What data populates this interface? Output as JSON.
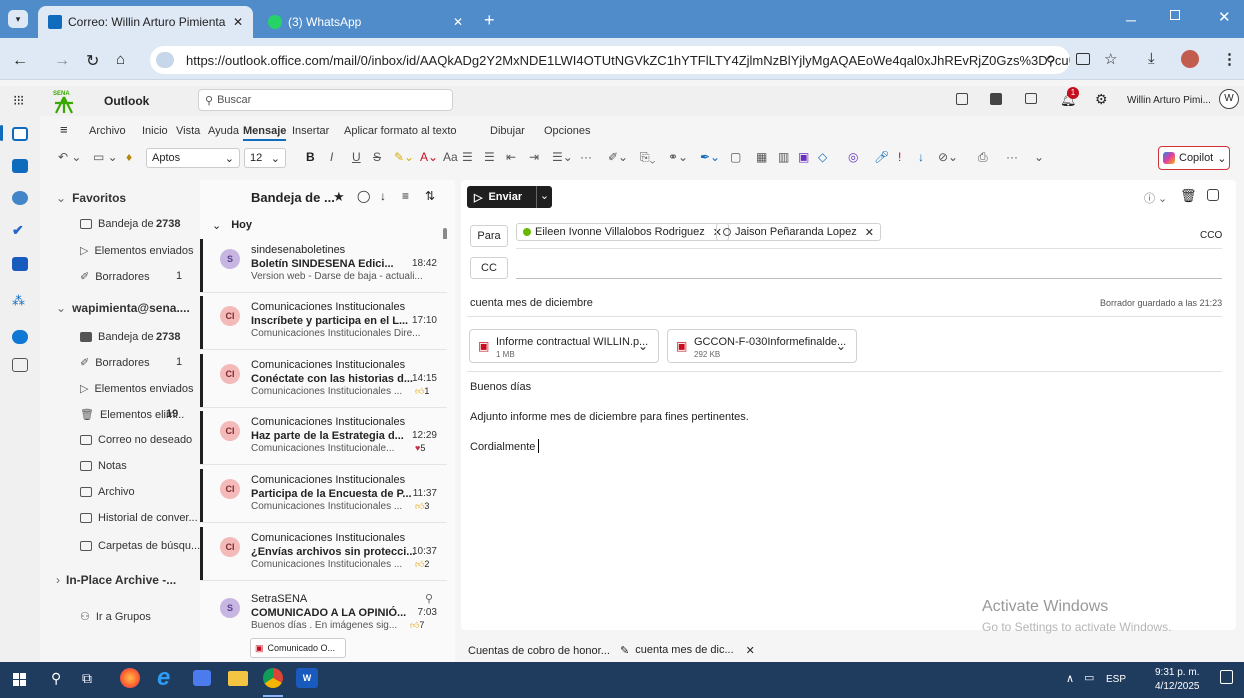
{
  "browser": {
    "tabs": [
      {
        "label": "Correo: Willin Arturo Pimienta I",
        "close": "✕"
      },
      {
        "label": "(3) WhatsApp",
        "close": "✕"
      }
    ],
    "new_tab": "+",
    "url": "https://outlook.office.com/mail/0/inbox/id/AAQkADg2Y2MxNDE1LWI4OTUtNGVkZC1hYTFlLTY4ZjlmNzBlYjlyMgAQAEoWe4qal0xJhREvRjZ0Gzs%3D?cult..."
  },
  "outlook": {
    "app_name": "Outlook",
    "search_placeholder": "Buscar",
    "user_name": "Willin Arturo Pimi...",
    "avatar_initial": "W",
    "notif_count": "1"
  },
  "ribbon": {
    "menu": [
      "Archivo",
      "Inicio",
      "Vista",
      "Ayuda",
      "Mensaje",
      "Insertar",
      "Aplicar formato al texto",
      "Dibujar",
      "Opciones"
    ],
    "font_name": "Aptos",
    "font_size": "12",
    "copilot": "Copilot"
  },
  "folders": {
    "favorites_label": "Favoritos",
    "favorites": [
      {
        "label": "Bandeja de ...",
        "count": "2738"
      },
      {
        "label": "Elementos enviados",
        "count": ""
      },
      {
        "label": "Borradores",
        "count": "1"
      }
    ],
    "account_label": "wapimienta@sena....",
    "account": [
      {
        "label": "Bandeja de ...",
        "count": "2738"
      },
      {
        "label": "Borradores",
        "count": "1"
      },
      {
        "label": "Elementos enviados",
        "count": ""
      },
      {
        "label": "Elementos elim...",
        "count": "19"
      },
      {
        "label": "Correo no deseado",
        "count": ""
      },
      {
        "label": "Notas",
        "count": ""
      },
      {
        "label": "Archivo",
        "count": ""
      },
      {
        "label": "Historial de conver...",
        "count": ""
      },
      {
        "label": "Carpetas de búsqu...",
        "count": ""
      }
    ],
    "archive_label": "In-Place Archive -...",
    "groups_label": "Ir a Grupos"
  },
  "message_list": {
    "title": "Bandeja de ...",
    "group_label": "Hoy",
    "messages": [
      {
        "initials": "S",
        "from": "sindesenaboletines",
        "subject": "Boletín SINDESENA Edici...",
        "time": "18:42",
        "preview": "Version web - Darse de baja - actuali...",
        "reactions": ""
      },
      {
        "initials": "CI",
        "from": "Comunicaciones Institucionales",
        "subject": "Inscríbete y participa en el L...",
        "time": "17:10",
        "preview": "Comunicaciones Institucionales Dire...",
        "reactions": ""
      },
      {
        "initials": "CI",
        "from": "Comunicaciones Institucionales",
        "subject": "Conéctate con las historias d...",
        "time": "14:15",
        "preview": "Comunicaciones Institucionales ...",
        "reactions": "1"
      },
      {
        "initials": "CI",
        "from": "Comunicaciones Institucionales",
        "subject": "Haz parte de la Estrategia d...",
        "time": "12:29",
        "preview": "Comunicaciones Institucionale...",
        "reactions": "5"
      },
      {
        "initials": "CI",
        "from": "Comunicaciones Institucionales",
        "subject": "Participa de la Encuesta de P...",
        "time": "11:37",
        "preview": "Comunicaciones Institucionales ...",
        "reactions": "3"
      },
      {
        "initials": "CI",
        "from": "Comunicaciones Institucionales",
        "subject": "¿Envías archivos sin protecci...",
        "time": "10:37",
        "preview": "Comunicaciones Institucionales ...",
        "reactions": "2"
      },
      {
        "initials": "S",
        "from": "SetraSENA",
        "subject": "COMUNICADO A LA OPINIÓ...",
        "time": "7:03",
        "preview": "Buenos días . En imágenes sig...",
        "reactions": "7"
      }
    ],
    "attachment_preview": "Comunicado O..."
  },
  "compose": {
    "send_label": "Enviar",
    "to_label": "Para",
    "cc_label": "CC",
    "cco_label": "CCO",
    "recipients": [
      "Eileen Ivonne Villalobos Rodriguez",
      "Jaison Peñaranda Lopez"
    ],
    "subject": "cuenta mes de diciembre",
    "draft_status": "Borrador guardado a las 21:23",
    "attachments": [
      {
        "name": "Informe contractual WILLIN.p...",
        "size": "1 MB"
      },
      {
        "name": "GCCON-F-030Informefinalde...",
        "size": "292 KB"
      }
    ],
    "body": [
      "Buenos días",
      "Adjunto informe mes de diciembre para fines pertinentes.",
      "Cordialmente"
    ]
  },
  "bottom_tabs": [
    "Cuentas de cobro de honor...",
    "cuenta mes de dic..."
  ],
  "watermark": {
    "title": "Activate Windows",
    "subtitle": "Go to Settings to activate Windows."
  },
  "taskbar": {
    "lang": "ESP",
    "time": "9:31 p. m.",
    "date": "4/12/2025"
  }
}
